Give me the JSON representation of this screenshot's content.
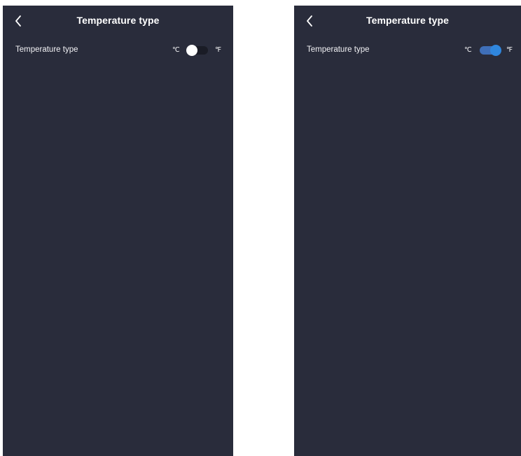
{
  "colors": {
    "screen_background": "#292c3b",
    "toggle_on_accent": "#2f86dd",
    "toggle_off_track": "#1a1c26"
  },
  "screens": [
    {
      "title": "Temperature type",
      "back_icon": "chevron-left-icon",
      "setting": {
        "label": "Temperature type",
        "unit_left": "℃",
        "unit_right": "℉",
        "toggle_on": false
      }
    },
    {
      "title": "Temperature type",
      "back_icon": "chevron-left-icon",
      "setting": {
        "label": "Temperature type",
        "unit_left": "℃",
        "unit_right": "℉",
        "toggle_on": true
      }
    }
  ]
}
